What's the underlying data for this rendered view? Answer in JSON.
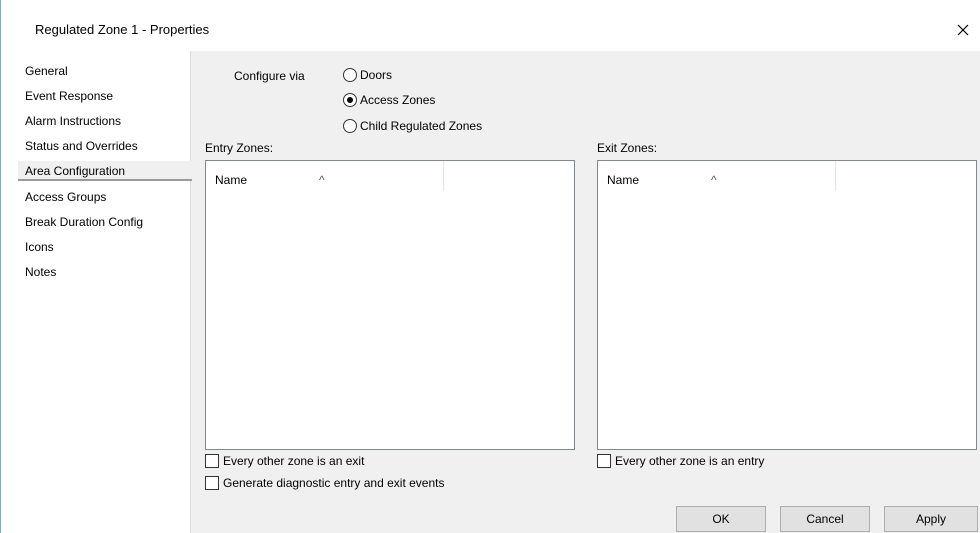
{
  "window": {
    "title": "Regulated Zone 1 - Properties",
    "close_icon": "close-icon"
  },
  "sidebar": {
    "items": [
      {
        "label": "General",
        "selected": false
      },
      {
        "label": "Event Response",
        "selected": false
      },
      {
        "label": "Alarm Instructions",
        "selected": false
      },
      {
        "label": "Status and Overrides",
        "selected": false
      },
      {
        "label": "Area Configuration",
        "selected": true
      },
      {
        "label": "Access Groups",
        "selected": false
      },
      {
        "label": "Break Duration Config",
        "selected": false
      },
      {
        "label": "Icons",
        "selected": false
      },
      {
        "label": "Notes",
        "selected": false
      }
    ]
  },
  "configure": {
    "label": "Configure via",
    "options": [
      {
        "label": "Doors",
        "checked": false
      },
      {
        "label": "Access Zones",
        "checked": true
      },
      {
        "label": "Child Regulated Zones",
        "checked": false
      }
    ]
  },
  "entry": {
    "label": "Entry Zones:",
    "column": "Name",
    "checkboxes": [
      {
        "label": "Every other zone is an exit",
        "checked": false
      },
      {
        "label": "Generate diagnostic entry and exit events",
        "checked": false
      }
    ]
  },
  "exit": {
    "label": "Exit Zones:",
    "column": "Name",
    "checkboxes": [
      {
        "label": "Every other zone is an entry",
        "checked": false
      }
    ]
  },
  "buttons": {
    "ok": "OK",
    "cancel": "Cancel",
    "apply": "Apply"
  }
}
